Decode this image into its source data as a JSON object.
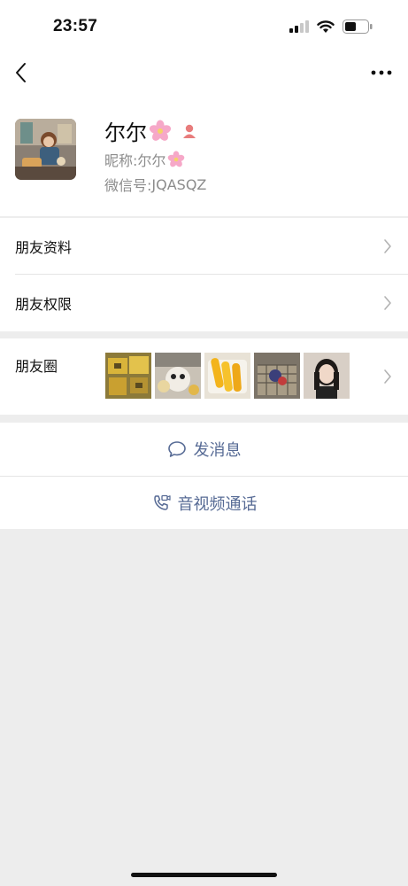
{
  "status_bar": {
    "time": "23:57",
    "icons": [
      "cellular-signal-icon",
      "wifi-icon",
      "battery-icon"
    ]
  },
  "nav": {
    "back_icon": "chevron-left-icon",
    "more_icon": "more-dots-icon"
  },
  "profile": {
    "name": "尔尔",
    "nickname_label": "昵称:",
    "nickname": "尔尔",
    "wechat_id_label": "微信号:",
    "wechat_id": "JQASQZ",
    "name_emoji": "cherry-blossom-icon",
    "gender_icon": "female-icon"
  },
  "menu": {
    "friend_info": "朋友资料",
    "friend_permissions": "朋友权限",
    "moments": "朋友圈"
  },
  "moments_thumbnails": [
    "thumb-1",
    "thumb-2",
    "thumb-3",
    "thumb-4",
    "thumb-5"
  ],
  "actions": {
    "send_message": "发消息",
    "video_call": "音视频通话"
  },
  "colors": {
    "link_blue": "#576b95",
    "background": "#ededed",
    "gender_female": "#e87c7c"
  }
}
